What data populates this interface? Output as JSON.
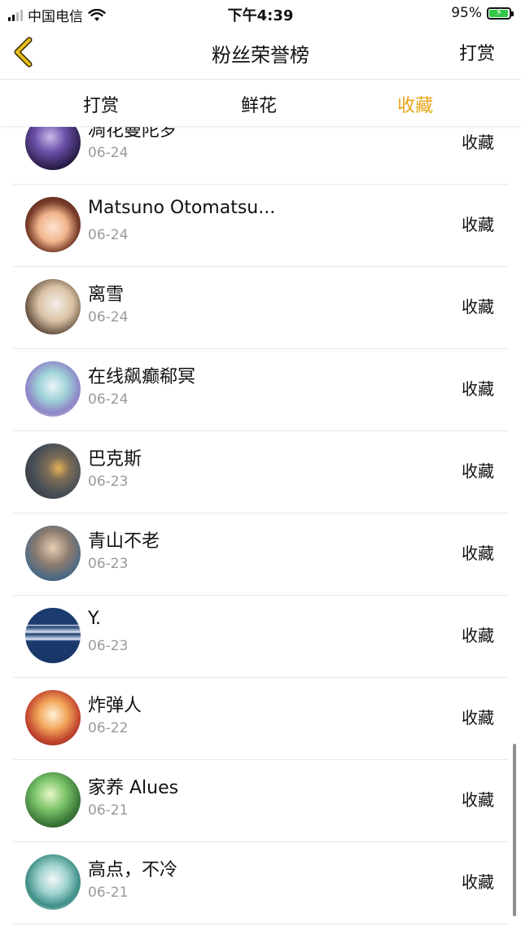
{
  "status_bar": {
    "carrier": "中国电信",
    "time": "下午4:39",
    "battery": "95%",
    "battery_level": 0.95
  },
  "nav": {
    "title": "粉丝荣誉榜",
    "right_action": "打赏"
  },
  "tabs": [
    {
      "label": "打赏"
    },
    {
      "label": "鲜花"
    },
    {
      "label": "收藏",
      "active": true
    }
  ],
  "colors": {
    "accent": "#e9a516",
    "back_arrow": "#e9bf1f"
  },
  "rows": [
    {
      "name": "凋花曼陀罗",
      "date": "06-24",
      "action": "收藏"
    },
    {
      "name": "Matsuno Otomatsu...",
      "date": "06-24",
      "action": "收藏"
    },
    {
      "name": "离雪",
      "date": "06-24",
      "action": "收藏"
    },
    {
      "name": "在线飙癫郗冥",
      "date": "06-24",
      "action": "收藏"
    },
    {
      "name": "巴克斯",
      "date": "06-23",
      "action": "收藏"
    },
    {
      "name": "青山不老",
      "date": "06-23",
      "action": "收藏"
    },
    {
      "name": "Y.",
      "date": "06-23",
      "action": "收藏"
    },
    {
      "name": "炸弹人",
      "date": "06-22",
      "action": "收藏"
    },
    {
      "name": "家养 Alues",
      "date": "06-21",
      "action": "收藏"
    },
    {
      "name": "高点，不冷",
      "date": "06-21",
      "action": "收藏"
    }
  ]
}
